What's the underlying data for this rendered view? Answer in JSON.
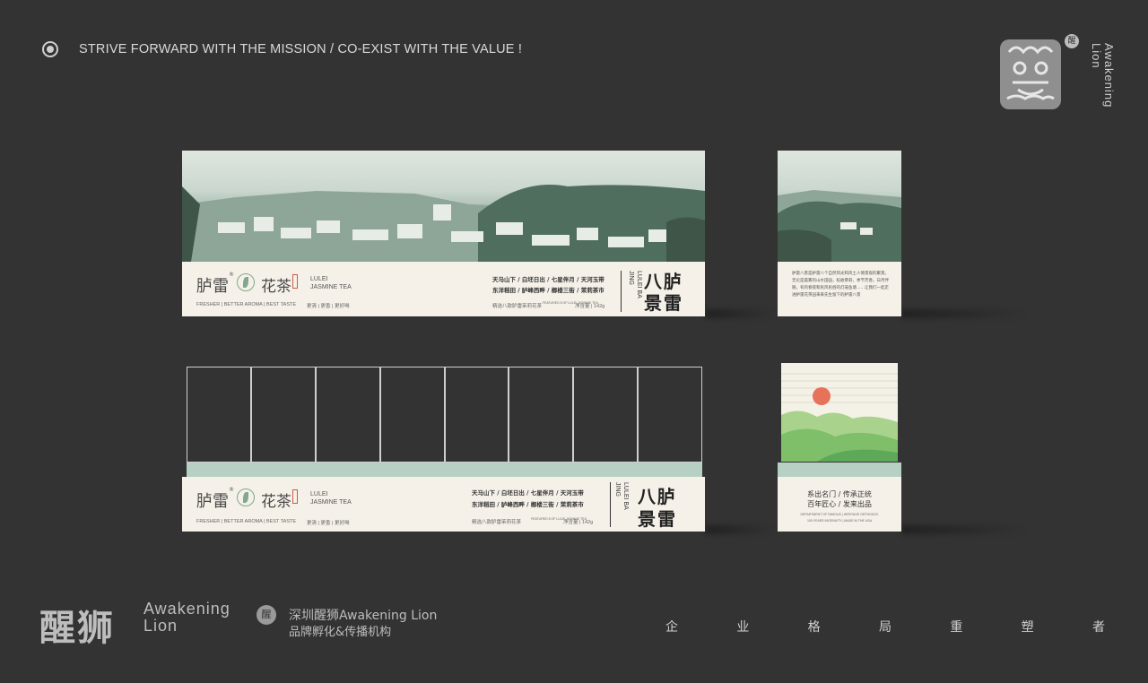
{
  "header": {
    "slogan": "STRIVE FORWARD WITH THE  MISSION / CO-EXIST WITH THE VALUE !",
    "logo_text": "Awakening Lion",
    "logo_seal": "醒"
  },
  "package": {
    "brand_cn": "胪雷",
    "brand_reg": "®",
    "tea_cn": "花茶",
    "sub_en_1": "LULEI",
    "sub_en_2": "JASMINE TEA",
    "tagline_en": "FRESHER | BETTER AROMA | BEST TASTE",
    "tagline_cn": "更清 | 更香 | 更好喝",
    "phrase_row1": "天马山下 / 白坯日出 / 七星伴月 / 天河玉带",
    "phrase_row2": "东洋稻田 / 胪峰西畔 / 榔楼三街 / 茉莉茶市",
    "product_desc": "精选八款胪雷茉莉花茶",
    "tiny_note": "FEATURED 8 OF LULEI JASMINE TEA",
    "net_weight": "净含量 | 142g",
    "vert_en": "LULEI BA JING",
    "title_top": "八胪",
    "title_bot": "景雷",
    "side_text": "胪雷八景是胪雷八个自然风光和风土人情景观的聚景。无论是晨雾的山水田园，稻收茉莉，季节芳香，日月伴随，有的春夜和民风民俗的灯笼鱼塘……让我们一起走进胪雷花茶园来来先生留下的胪雷八景",
    "side_slogan_1": "系出名门 / 传承正统",
    "side_slogan_2": "百年匠心 / 发来出品",
    "side_small_1": "DEPARTMENT OF FAMOUS | HERITAGE ORTHODOX",
    "side_small_2": "100 YEARS INGENUITY | MADE IN THE USA"
  },
  "colors": {
    "background": "#333333",
    "mint": "#b6d1c3",
    "cream": "#f5f1e8",
    "sun": "#e8715a"
  },
  "footer": {
    "brand_cn": "醒狮",
    "brand_en_1": "Awakening",
    "brand_en_2": "Lion",
    "seal": "醒",
    "company_1": "深圳醒狮Awakening Lion",
    "company_2": "品牌孵化&传播机构",
    "slogan_chars": [
      "企",
      "业",
      "格",
      "局",
      "重",
      "塑",
      "者"
    ]
  }
}
